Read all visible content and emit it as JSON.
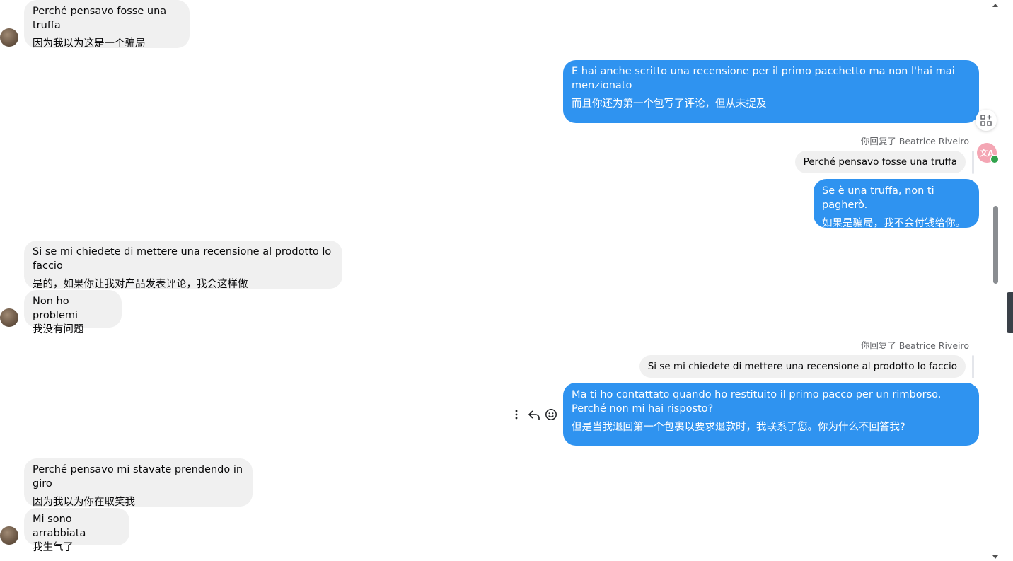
{
  "messages": {
    "m1": {
      "it": "Perché pensavo fosse una truffa",
      "zh": "因为我以为这是一个骗局"
    },
    "m2": {
      "it": "E hai anche scritto una recensione per il primo pacchetto ma non l'hai mai menzionato",
      "zh": "而且你还为第一个包写了评论，但从未提及"
    },
    "m3": {
      "reply_label": "你回复了 Beatrice Riveiro",
      "quote": "Perché pensavo fosse una truffa"
    },
    "m4": {
      "it": "Se è una truffa, non ti pagherò.",
      "zh": "如果是骗局，我不会付钱给你。"
    },
    "m5": {
      "it": "Si se mi chiedete di mettere una recensione al prodotto lo faccio",
      "zh": "是的，如果你让我对产品发表评论，我会这样做"
    },
    "m6": {
      "it": "Non ho problemi",
      "zh": "我没有问题"
    },
    "m7": {
      "reply_label": "你回复了 Beatrice Riveiro",
      "quote": "Si se mi chiedete di mettere una recensione al prodotto lo faccio"
    },
    "m8": {
      "it": "Ma ti ho contattato quando ho restituito il primo pacco per un rimborso. Perché non mi hai risposto?",
      "zh": "但是当我退回第一个包裹以要求退款时，我联系了您。你为什么不回答我?"
    },
    "m9": {
      "it": "Perché pensavo mi stavate prendendo in giro",
      "zh": "因为我以为你在取笑我"
    },
    "m10": {
      "it": "Mi sono arrabbiata",
      "zh": "我生气了"
    }
  },
  "side": {
    "translate_glyph": "文A"
  },
  "icons": {
    "more": "more-vertical-icon",
    "reply": "reply-icon",
    "react": "smiley-icon",
    "apps": "apps-add-icon"
  },
  "colors": {
    "outgoing": "#2f93f0",
    "incoming": "#f0f0f0"
  }
}
